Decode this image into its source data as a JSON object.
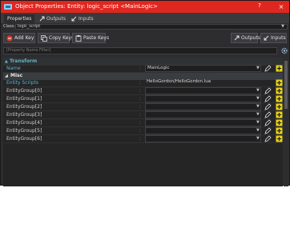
{
  "window": {
    "title": "Object Properties: Entity: logic_script <MainLogic>",
    "help_label": "?",
    "close_label": "×"
  },
  "tabs": [
    {
      "label": "Properties",
      "active": true
    },
    {
      "label": "Outputs",
      "active": false
    },
    {
      "label": "Inputs",
      "active": false
    }
  ],
  "class_row": {
    "label": "Class:",
    "value": "logic_script"
  },
  "toolbar": {
    "add_key": "Add Key",
    "copy_keys": "Copy Keys",
    "paste_keys": "Paste Keys",
    "outputs": "Outputs",
    "inputs": "Inputs"
  },
  "filter": {
    "placeholder": "[Property Name Filter]"
  },
  "grid": {
    "category": "Transform",
    "subcategory": "Misc",
    "properties": [
      {
        "name": "Name",
        "value": "MainLogic",
        "dropdown": true,
        "highlight": true
      },
      {
        "name": "Entity Scripts",
        "value": "HelloGordon/HelloGordon.lua",
        "dropdown": false,
        "highlight": true
      },
      {
        "name": "EntityGroup[0]",
        "value": "",
        "dropdown": true,
        "highlight": false
      },
      {
        "name": "EntityGroup[1]",
        "value": "",
        "dropdown": true,
        "highlight": false
      },
      {
        "name": "EntityGroup[2]",
        "value": "",
        "dropdown": true,
        "highlight": false
      },
      {
        "name": "EntityGroup[3]",
        "value": "",
        "dropdown": true,
        "highlight": false
      },
      {
        "name": "EntityGroup[4]",
        "value": "",
        "dropdown": true,
        "highlight": false
      },
      {
        "name": "EntityGroup[5]",
        "value": "",
        "dropdown": true,
        "highlight": false
      },
      {
        "name": "EntityGroup[6]",
        "value": "",
        "dropdown": true,
        "highlight": false
      }
    ]
  },
  "colors": {
    "titlebar": "#e0271f",
    "category_text": "#5fb4c7",
    "highlight_name": "#56b6d6",
    "add_icon": "#e6d21a"
  }
}
